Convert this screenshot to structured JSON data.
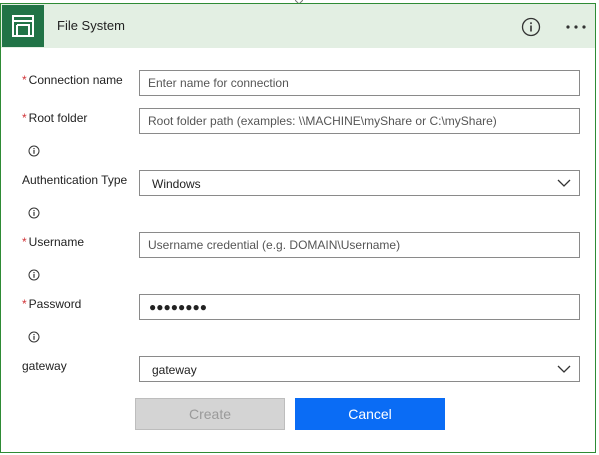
{
  "header": {
    "title": "File System",
    "app_icon": "file-system-icon",
    "info_icon": "info-icon",
    "more_icon": "more-icon",
    "more_label": "···",
    "accent_color": "#217346",
    "header_bg": "#e3efe3"
  },
  "form": {
    "connection_name": {
      "label": "Connection name",
      "required": "*",
      "placeholder": "Enter name for connection",
      "value": ""
    },
    "root_folder": {
      "label": "Root folder",
      "required": "*",
      "placeholder": "Root folder path (examples: \\\\MACHINE\\myShare or C:\\myShare)",
      "value": ""
    },
    "auth_type": {
      "label": "Authentication Type",
      "value": "Windows"
    },
    "username": {
      "label": "Username",
      "required": "*",
      "placeholder": "Username credential (e.g. DOMAIN\\Username)",
      "value": ""
    },
    "password": {
      "label": "Password",
      "required": "*",
      "value_masked": "●●●●●●●●"
    },
    "gateway": {
      "label": "gateway",
      "value": "gateway"
    }
  },
  "actions": {
    "create_label": "Create",
    "cancel_label": "Cancel",
    "cancel_color": "#0a6cf5"
  }
}
